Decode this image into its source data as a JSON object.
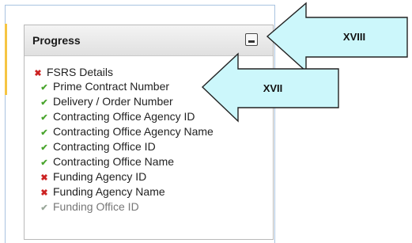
{
  "panel": {
    "title": "Progress"
  },
  "tree": {
    "root": {
      "label": "FSRS Details",
      "status": "incomplete"
    },
    "items": [
      {
        "label": "Prime Contract Number",
        "status": "complete"
      },
      {
        "label": "Delivery / Order Number",
        "status": "complete"
      },
      {
        "label": "Contracting Office Agency ID",
        "status": "complete"
      },
      {
        "label": "Contracting Office Agency Name",
        "status": "complete"
      },
      {
        "label": "Contracting Office ID",
        "status": "complete"
      },
      {
        "label": "Contracting Office Name",
        "status": "complete"
      },
      {
        "label": "Funding Agency ID",
        "status": "incomplete"
      },
      {
        "label": "Funding Agency Name",
        "status": "incomplete"
      },
      {
        "label": "Funding Office ID",
        "status": "complete"
      }
    ]
  },
  "callouts": {
    "upper": "XVIII",
    "lower": "XVII",
    "fill_color": "#ccf7fb",
    "stroke_color": "#222222"
  },
  "colors": {
    "check": "#4aa52e",
    "cross": "#cc2222"
  }
}
